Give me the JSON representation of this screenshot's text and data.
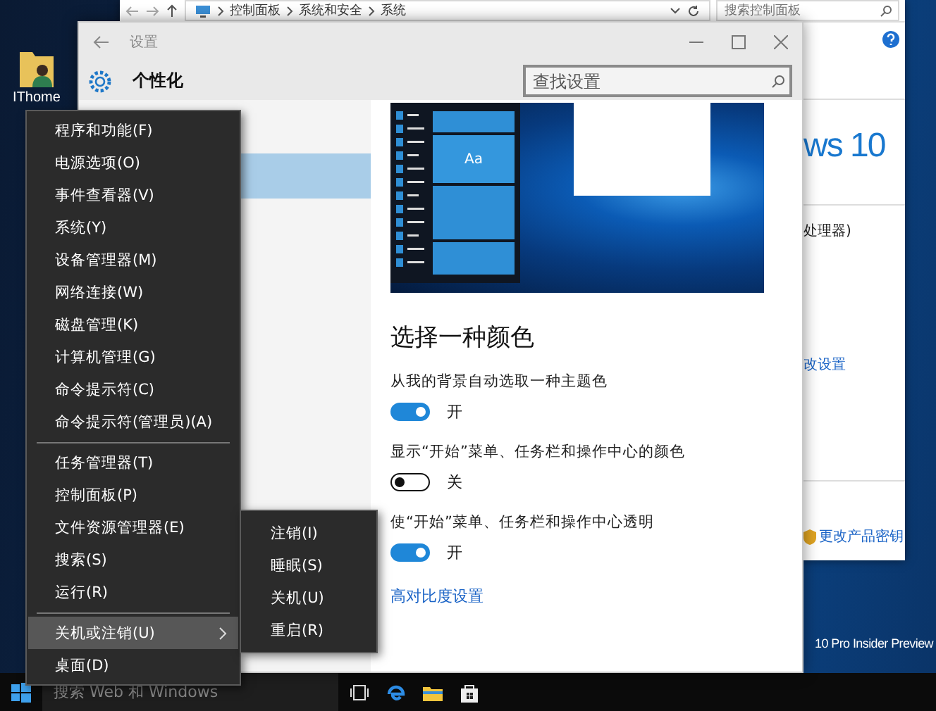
{
  "desktop": {
    "icons": [
      {
        "label": "IThome"
      }
    ],
    "edition_text": "10 Pro Insider Preview"
  },
  "control_panel_window": {
    "breadcrumbs": [
      "控制面板",
      "系统和安全",
      "系统"
    ],
    "search": {
      "placeholder": "搜索控制面板"
    },
    "logo_text": "ws 10",
    "processor_text": "处理器)",
    "links": [
      "改设置",
      "更改产品密钥"
    ]
  },
  "settings_window": {
    "title": "设置",
    "page_title": "个性化",
    "search": {
      "placeholder": "查找设置"
    },
    "preview_tile_text": "Aa",
    "section_title": "选择一种颜色",
    "options": [
      {
        "label": "从我的背景自动选取一种主题色",
        "on": true,
        "state_label": "开"
      },
      {
        "label": "显示“开始”菜单、任务栏和操作中心的颜色",
        "on": false,
        "state_label": "关"
      },
      {
        "label": "使“开始”菜单、任务栏和操作中心透明",
        "on": true,
        "state_label": "开"
      }
    ],
    "link": "高对比度设置"
  },
  "context_menu": {
    "groups": [
      {
        "items": [
          {
            "label": "程序和功能(F)",
            "selected": false,
            "has_submenu": false
          },
          {
            "label": "电源选项(O)",
            "selected": false,
            "has_submenu": false
          },
          {
            "label": "事件查看器(V)",
            "selected": false,
            "has_submenu": false
          },
          {
            "label": "系统(Y)",
            "selected": false,
            "has_submenu": false
          },
          {
            "label": "设备管理器(M)",
            "selected": false,
            "has_submenu": false
          },
          {
            "label": "网络连接(W)",
            "selected": false,
            "has_submenu": false
          },
          {
            "label": "磁盘管理(K)",
            "selected": false,
            "has_submenu": false
          },
          {
            "label": "计算机管理(G)",
            "selected": false,
            "has_submenu": false
          },
          {
            "label": "命令提示符(C)",
            "selected": false,
            "has_submenu": false
          },
          {
            "label": "命令提示符(管理员)(A)",
            "selected": false,
            "has_submenu": false
          }
        ]
      },
      {
        "items": [
          {
            "label": "任务管理器(T)",
            "selected": false,
            "has_submenu": false
          },
          {
            "label": "控制面板(P)",
            "selected": false,
            "has_submenu": false
          },
          {
            "label": "文件资源管理器(E)",
            "selected": false,
            "has_submenu": false
          },
          {
            "label": "搜索(S)",
            "selected": false,
            "has_submenu": false
          },
          {
            "label": "运行(R)",
            "selected": false,
            "has_submenu": false
          }
        ]
      },
      {
        "items": [
          {
            "label": "关机或注销(U)",
            "selected": true,
            "has_submenu": true
          },
          {
            "label": "桌面(D)",
            "selected": false,
            "has_submenu": false
          }
        ]
      }
    ]
  },
  "submenu": {
    "items": [
      "注销(I)",
      "睡眠(S)",
      "关机(U)",
      "重启(R)"
    ]
  },
  "taskbar": {
    "search": {
      "placeholder": "搜索 Web 和 Windows"
    }
  }
}
